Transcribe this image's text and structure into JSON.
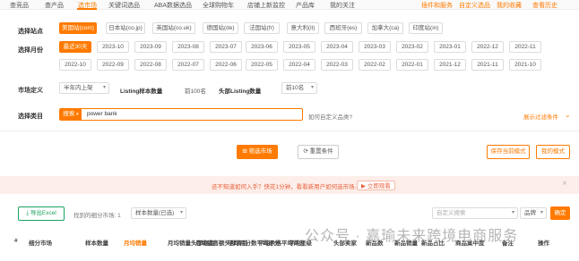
{
  "nav": {
    "items": [
      "查竞品",
      "查产品",
      "选市场",
      "关键词选品",
      "ABA数据选品",
      "全球购物车",
      "店铺上新监控",
      "产品库",
      "我的关注"
    ],
    "active_index": 2,
    "right_links": [
      "插件和服务",
      "自定义选品",
      "我的收藏",
      "查看历史"
    ]
  },
  "site": {
    "label": "选择站点",
    "options": [
      "美国站(com)",
      "日本站(co.jp)",
      "英国站(co.uk)",
      "德国站(de)",
      "法国站(fr)",
      "意大利(it)",
      "西班牙(es)",
      "加拿大(ca)",
      "印度站(in)"
    ],
    "selected_index": 0
  },
  "month": {
    "label": "选择月份",
    "row1": [
      "最近30天",
      "2023-10",
      "2023-09",
      "2023-08",
      "2023-07",
      "2023-06",
      "2023-05",
      "2023-04",
      "2023-03",
      "2023-02",
      "2023-01",
      "2022-12",
      "2022-11"
    ],
    "row2": [
      "2022-10",
      "2022-09",
      "2022-08",
      "2022-07",
      "2022-06",
      "2022-05",
      "2022-04",
      "2022-03",
      "2022-02",
      "2022-01",
      "2021-12",
      "2021-11",
      "2021-10"
    ],
    "selected": "最近30天"
  },
  "market_def": {
    "label": "市场定义",
    "time_select": "半年内上架",
    "sample_label": "Listing样本数量",
    "sample_value": "前100名",
    "head_label": "头部Listing数量",
    "head_select": "前10名"
  },
  "category": {
    "label": "选择类目",
    "search_tag": "搜索",
    "input_value": "power bank",
    "custom_link": "如何自定义品类?",
    "expand_link": "展示过滤条件"
  },
  "actions": {
    "filter_button": "筛选市场",
    "reset_button": "重置条件",
    "save_button": "保存当前模式",
    "my_mode_button": "我的模式"
  },
  "notice": {
    "text": "还不知道如何入手？快花1分钟，看看新用户如何选市场…",
    "video_button": "立即观看",
    "close": "×"
  },
  "results": {
    "export_button": "导出Excel",
    "count_text": "找到的细分市场: 1",
    "sort_select": "样本数量(已选)",
    "search_placeholder": "自定义搜索",
    "field_select": "品牌",
    "go_button": "确定"
  },
  "table_headers": [
    "#",
    "细分市场",
    "样本数量",
    "月均销量",
    "月均销量头部商品",
    "月均销售额头部商品",
    "平均评分数平均评分",
    "平均价格平均评分",
    "平均星级",
    "头部卖家",
    "新品数",
    "新品销量",
    "新品占比",
    "商品集中度",
    "备注",
    "操作"
  ],
  "watermark": "公众号 · 嘉瑜未来跨境电商服务"
}
